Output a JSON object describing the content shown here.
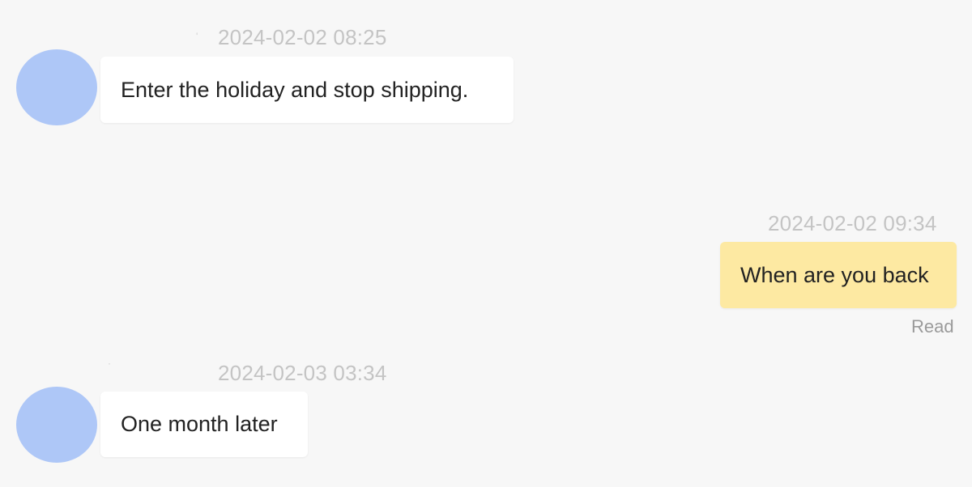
{
  "messages": [
    {
      "direction": "incoming",
      "timestamp": "2024-02-02 08:25",
      "text": "Enter the holiday and stop shipping."
    },
    {
      "direction": "outgoing",
      "timestamp": "2024-02-02 09:34",
      "text": "When are you back",
      "status": "Read"
    },
    {
      "direction": "incoming",
      "timestamp": "2024-02-03 03:34",
      "text": "One month later"
    }
  ],
  "colors": {
    "background": "#f7f7f7",
    "incoming_bubble": "#ffffff",
    "outgoing_bubble": "#fde9a2",
    "avatar": "#aec7f7",
    "timestamp": "#c4c4c4"
  }
}
